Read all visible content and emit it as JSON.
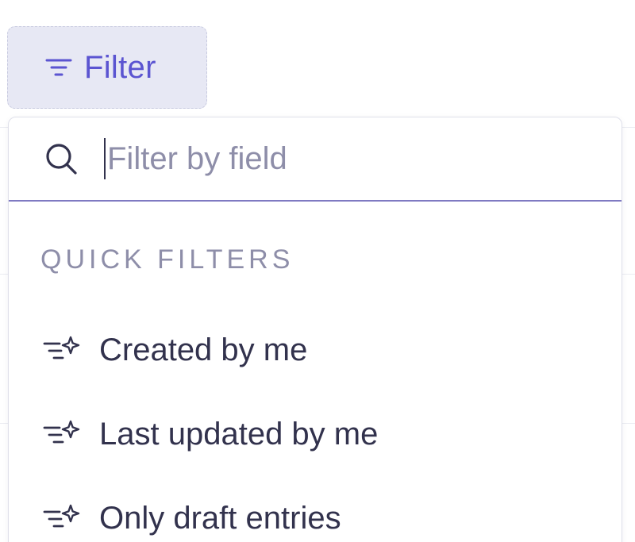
{
  "filter_button": {
    "label": "Filter",
    "icon": "filter-icon",
    "accent_color": "#5b54d1"
  },
  "dropdown": {
    "search": {
      "icon": "search-icon",
      "value": "",
      "placeholder": "Filter by field"
    },
    "quick_filters": {
      "heading": "QUICK FILTERS",
      "items": [
        {
          "label": "Created by me",
          "icon": "magic-filter-icon"
        },
        {
          "label": "Last updated by me",
          "icon": "magic-filter-icon"
        },
        {
          "label": "Only draft entries",
          "icon": "magic-filter-icon"
        }
      ]
    }
  }
}
